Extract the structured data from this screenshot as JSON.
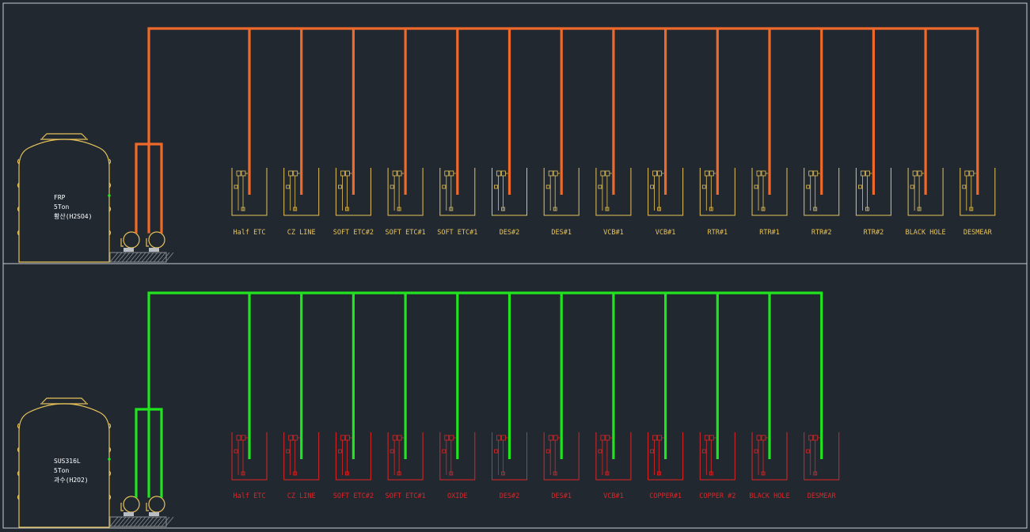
{
  "colors": {
    "background": "#212830",
    "border": "#c9ccd0",
    "tank": "#e6c25a",
    "pipe_acid": "#ef6a2a",
    "pipe_peroxide": "#21e41f",
    "bath_acid": "#e6c25a",
    "bath_peroxide": "#e22424"
  },
  "systems": [
    {
      "name": "h2so4-system",
      "tank": {
        "lines": [
          "FRP",
          "5Ton",
          "황산(H2SO4)"
        ]
      },
      "pipe_color": "#ef6a2a",
      "bath_color": "#e6c25a",
      "baths": [
        {
          "label": "Half ETC"
        },
        {
          "label": "CZ LINE"
        },
        {
          "label": "SOFT ETC#2"
        },
        {
          "label": "SOFT ETC#1"
        },
        {
          "label": "SOFT ETC#1"
        },
        {
          "label": "DES#2"
        },
        {
          "label": "DES#1"
        },
        {
          "label": "VCB#1"
        },
        {
          "label": "VCB#1"
        },
        {
          "label": "RTR#1"
        },
        {
          "label": "RTR#1"
        },
        {
          "label": "RTR#2"
        },
        {
          "label": "RTR#2"
        },
        {
          "label": "BLACK HOLE"
        },
        {
          "label": "DESMEAR"
        }
      ]
    },
    {
      "name": "h2o2-system",
      "tank": {
        "lines": [
          "SUS316L",
          "5Ton",
          "과수(H2O2)"
        ]
      },
      "pipe_color": "#21e41f",
      "bath_color": "#e22424",
      "baths": [
        {
          "label": "Half ETC"
        },
        {
          "label": "CZ LINE"
        },
        {
          "label": "SOFT ETC#2"
        },
        {
          "label": "SOFT ETC#1"
        },
        {
          "label": "OXIDE"
        },
        {
          "label": "DES#2"
        },
        {
          "label": "DES#1"
        },
        {
          "label": "VCB#1"
        },
        {
          "label": "COPPER#1"
        },
        {
          "label": "COPPER #2"
        },
        {
          "label": "BLACK HOLE"
        },
        {
          "label": "DESMEAR"
        }
      ]
    }
  ]
}
